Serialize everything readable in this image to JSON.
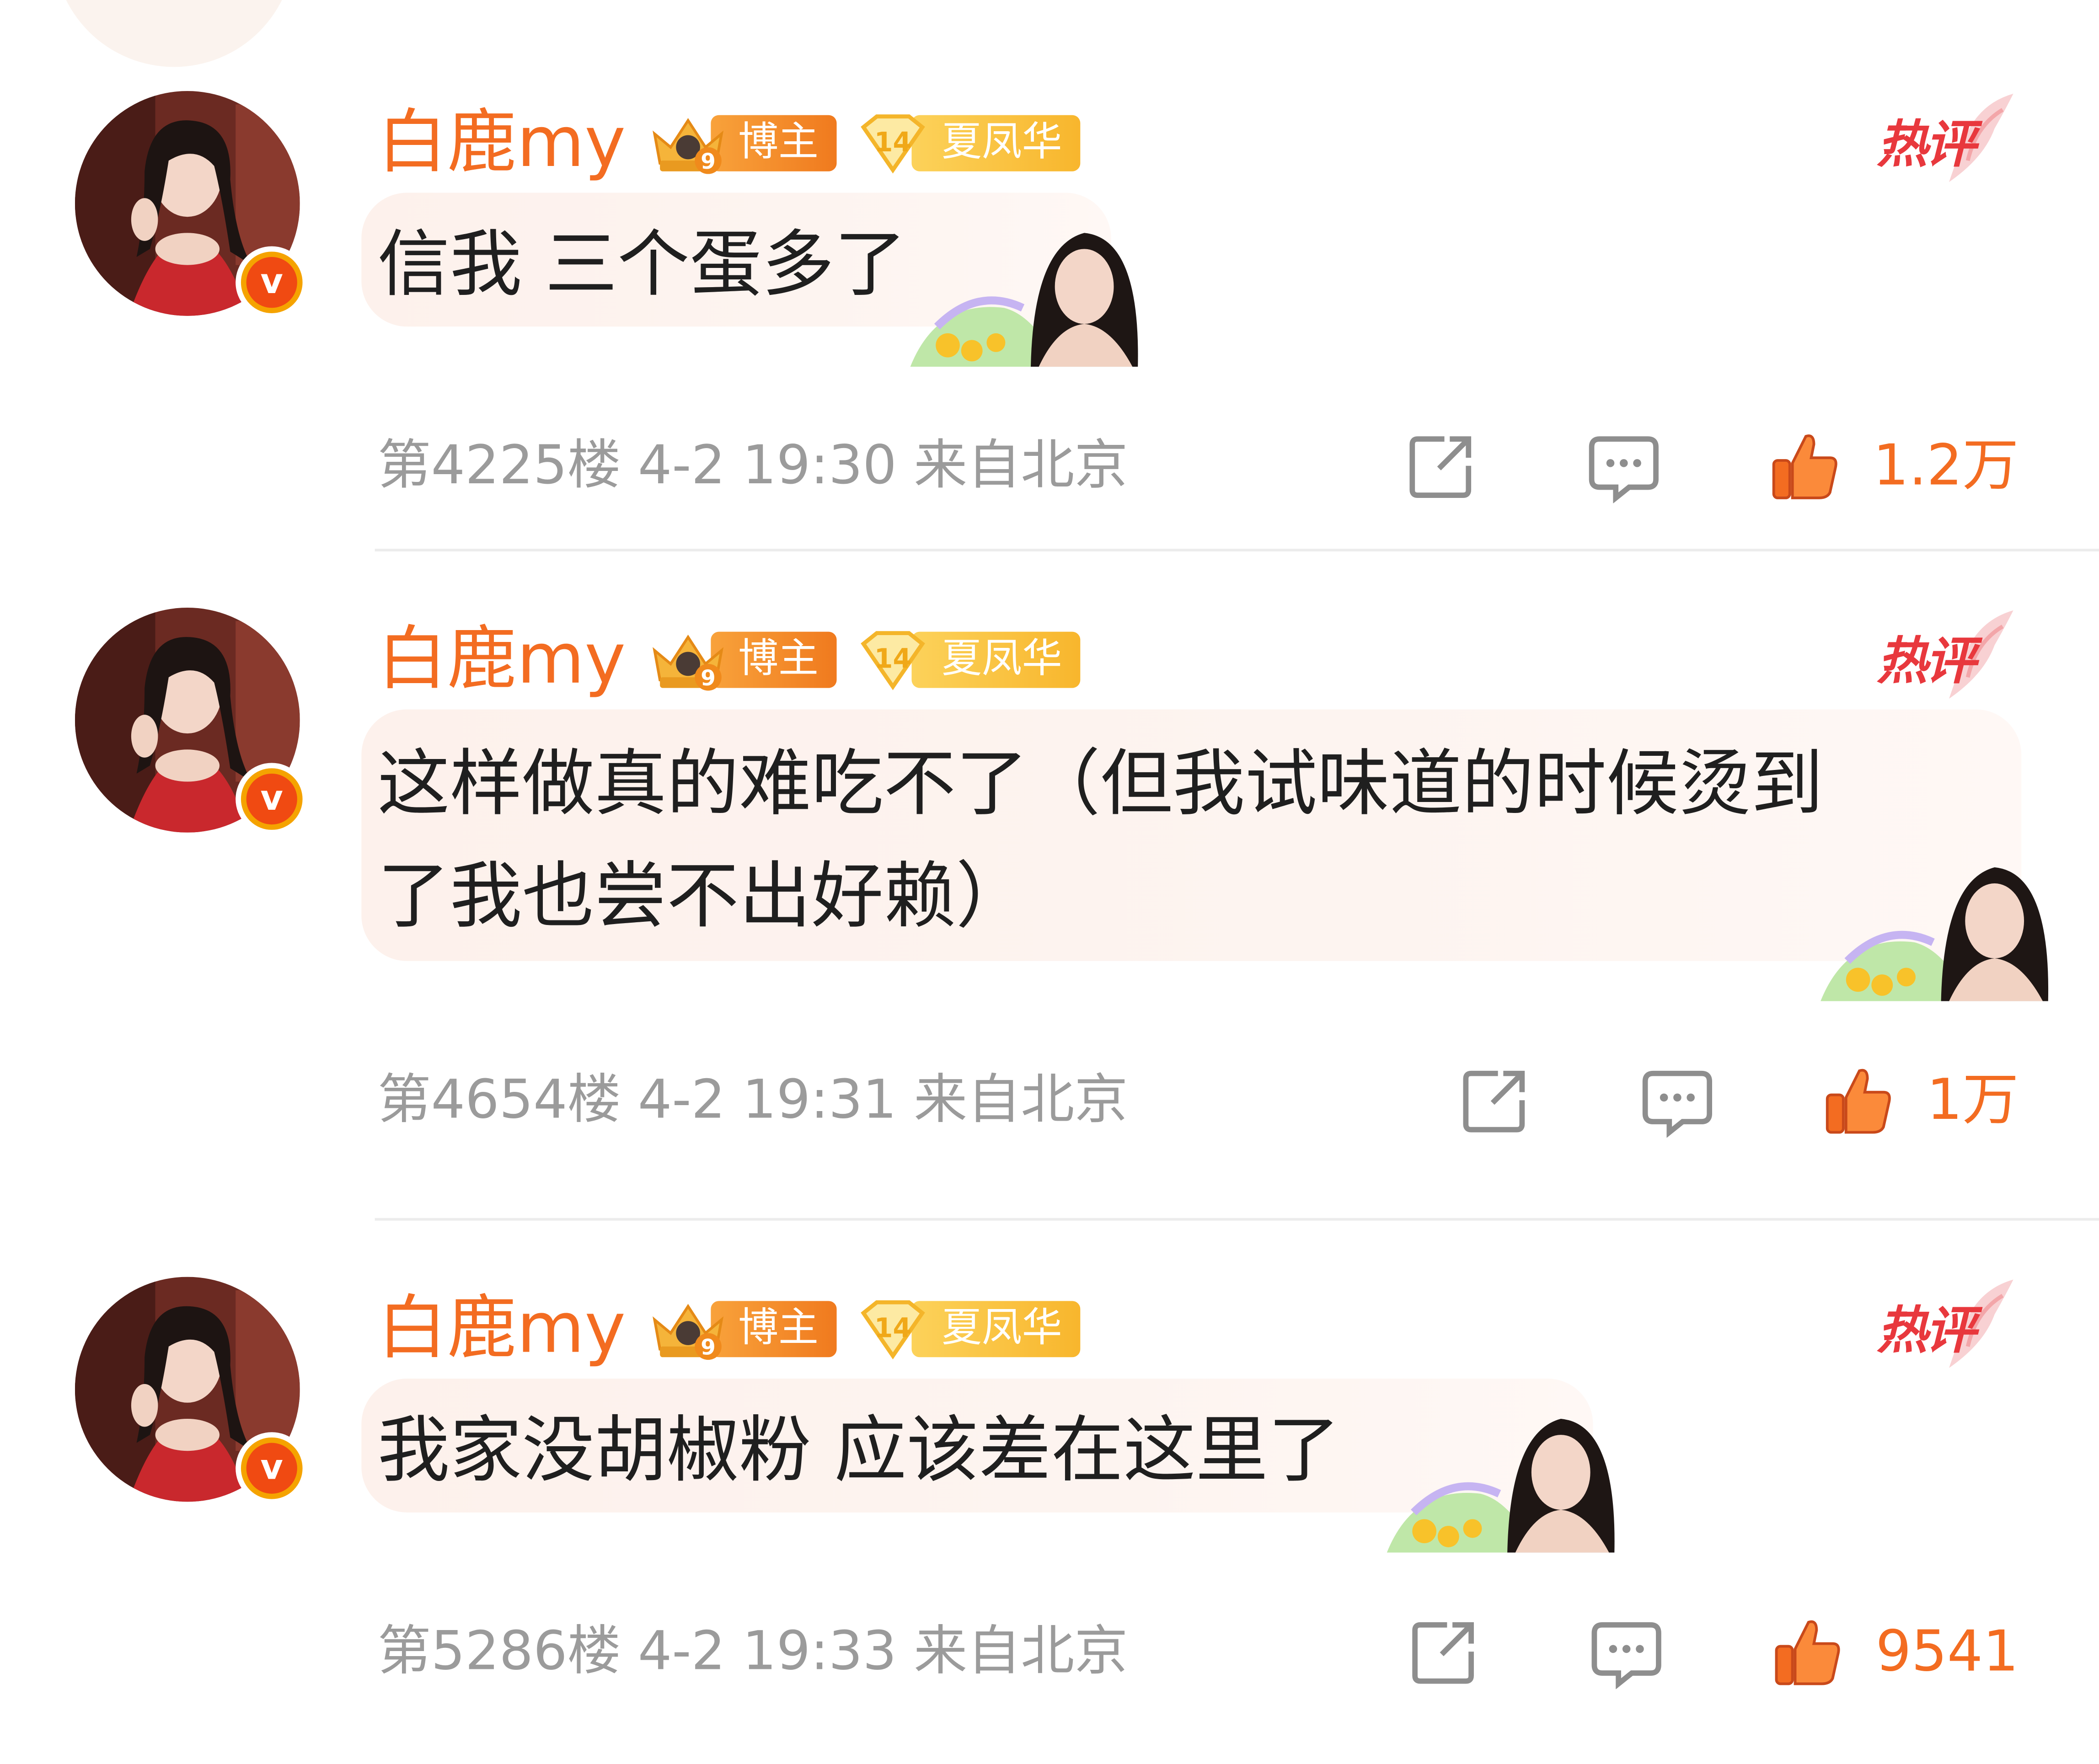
{
  "theme": {
    "accent": "#f36c21",
    "hot_red": "#e8383d",
    "meta_gray": "#9b9b9b",
    "text_dark": "#1f1f1f"
  },
  "comments": [
    {
      "username": "白鹿my",
      "blogger_badge": "博主",
      "blogger_level": "9",
      "fan_level": "14",
      "fan_badge": "夏凤华",
      "hot_label": "热评",
      "text_lines": [
        "信我 三个蛋多了"
      ],
      "floor": "第4225楼",
      "date": "4-2",
      "time": "19:30",
      "location": "来自北京",
      "likes": "1.2万"
    },
    {
      "username": "白鹿my",
      "blogger_badge": "博主",
      "blogger_level": "9",
      "fan_level": "14",
      "fan_badge": "夏凤华",
      "hot_label": "热评",
      "text_lines": [
        "这样做真的难吃不了（但我试味道的时候烫到",
        "了我也尝不出好赖）"
      ],
      "floor": "第4654楼",
      "date": "4-2",
      "time": "19:31",
      "location": "来自北京",
      "likes": "1万"
    },
    {
      "username": "白鹿my",
      "blogger_badge": "博主",
      "blogger_level": "9",
      "fan_level": "14",
      "fan_badge": "夏凤华",
      "hot_label": "热评",
      "text_lines": [
        "我家没胡椒粉 应该差在这里了"
      ],
      "floor": "第5286楼",
      "date": "4-2",
      "time": "19:33",
      "location": "来自北京",
      "likes": "9541"
    }
  ],
  "icons": {
    "share": "share-icon",
    "reply": "comment-icon",
    "like": "thumbs-up-icon",
    "verified": "verified-v-icon"
  }
}
